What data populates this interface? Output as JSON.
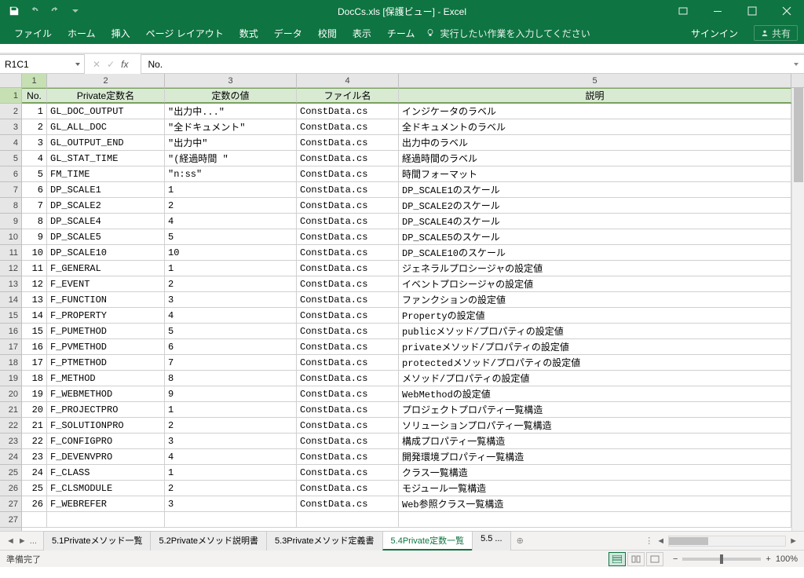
{
  "app": {
    "title": "DocCs.xls [保護ビュー] - Excel",
    "signin": "サインイン",
    "share": "共有",
    "tellme_placeholder": "実行したい作業を入力してください"
  },
  "ribbon": {
    "tabs": [
      "ファイル",
      "ホーム",
      "挿入",
      "ページ レイアウト",
      "数式",
      "データ",
      "校閲",
      "表示",
      "チーム"
    ]
  },
  "namebox": "R1C1",
  "formula": "No.",
  "col_numbers": [
    "1",
    "2",
    "3",
    "4",
    "5"
  ],
  "headers": {
    "no": "No.",
    "name": "Private定数名",
    "val": "定数の値",
    "file": "ファイル名",
    "desc": "説明"
  },
  "rows": [
    {
      "n": "1",
      "name": "GL_DOC_OUTPUT",
      "val": "\"出力中...\"",
      "file": "ConstData.cs",
      "desc": "インジケータのラベル"
    },
    {
      "n": "2",
      "name": "GL_ALL_DOC",
      "val": "\"全ドキュメント\"",
      "file": "ConstData.cs",
      "desc": "全ドキュメントのラベル"
    },
    {
      "n": "3",
      "name": "GL_OUTPUT_END",
      "val": "\"出力中\"",
      "file": "ConstData.cs",
      "desc": "出力中のラベル"
    },
    {
      "n": "4",
      "name": "GL_STAT_TIME",
      "val": "\"(経過時間 \"",
      "file": "ConstData.cs",
      "desc": "経過時間のラベル"
    },
    {
      "n": "5",
      "name": "FM_TIME",
      "val": "\"n:ss\"",
      "file": "ConstData.cs",
      "desc": "時間フォーマット"
    },
    {
      "n": "6",
      "name": "DP_SCALE1",
      "val": "1",
      "file": "ConstData.cs",
      "desc": "DP_SCALE1のスケール"
    },
    {
      "n": "7",
      "name": "DP_SCALE2",
      "val": "2",
      "file": "ConstData.cs",
      "desc": "DP_SCALE2のスケール"
    },
    {
      "n": "8",
      "name": "DP_SCALE4",
      "val": "4",
      "file": "ConstData.cs",
      "desc": "DP_SCALE4のスケール"
    },
    {
      "n": "9",
      "name": "DP_SCALE5",
      "val": "5",
      "file": "ConstData.cs",
      "desc": "DP_SCALE5のスケール"
    },
    {
      "n": "10",
      "name": "DP_SCALE10",
      "val": "10",
      "file": "ConstData.cs",
      "desc": "DP_SCALE10のスケール"
    },
    {
      "n": "11",
      "name": "F_GENERAL",
      "val": "1",
      "file": "ConstData.cs",
      "desc": "ジェネラルプロシージャの設定値"
    },
    {
      "n": "12",
      "name": "F_EVENT",
      "val": "2",
      "file": "ConstData.cs",
      "desc": "イベントプロシージャの設定値"
    },
    {
      "n": "13",
      "name": "F_FUNCTION",
      "val": "3",
      "file": "ConstData.cs",
      "desc": "ファンクションの設定値"
    },
    {
      "n": "14",
      "name": "F_PROPERTY",
      "val": "4",
      "file": "ConstData.cs",
      "desc": "Propertyの設定値"
    },
    {
      "n": "15",
      "name": "F_PUMETHOD",
      "val": "5",
      "file": "ConstData.cs",
      "desc": "publicメソッド/プロパティの設定値"
    },
    {
      "n": "16",
      "name": "F_PVMETHOD",
      "val": "6",
      "file": "ConstData.cs",
      "desc": "privateメソッド/プロパティの設定値"
    },
    {
      "n": "17",
      "name": "F_PTMETHOD",
      "val": "7",
      "file": "ConstData.cs",
      "desc": "protectedメソッド/プロパティの設定値"
    },
    {
      "n": "18",
      "name": "F_METHOD",
      "val": "8",
      "file": "ConstData.cs",
      "desc": "メソッド/プロパティの設定値"
    },
    {
      "n": "19",
      "name": "F_WEBMETHOD",
      "val": "9",
      "file": "ConstData.cs",
      "desc": "WebMethodの設定値"
    },
    {
      "n": "20",
      "name": "F_PROJECTPRO",
      "val": "1",
      "file": "ConstData.cs",
      "desc": "プロジェクトプロパティ一覧構造"
    },
    {
      "n": "21",
      "name": "F_SOLUTIONPRO",
      "val": "2",
      "file": "ConstData.cs",
      "desc": "ソリューションプロパティ一覧構造"
    },
    {
      "n": "22",
      "name": "F_CONFIGPRO",
      "val": "3",
      "file": "ConstData.cs",
      "desc": "構成プロパティ一覧構造"
    },
    {
      "n": "23",
      "name": "F_DEVENVPRO",
      "val": "4",
      "file": "ConstData.cs",
      "desc": "開発環境プロパティ一覧構造"
    },
    {
      "n": "24",
      "name": "F_CLASS",
      "val": "1",
      "file": "ConstData.cs",
      "desc": "クラス一覧構造"
    },
    {
      "n": "25",
      "name": "F_CLSMODULE",
      "val": "2",
      "file": "ConstData.cs",
      "desc": "モジュール一覧構造"
    },
    {
      "n": "26",
      "name": "F_WEBREFER",
      "val": "3",
      "file": "ConstData.cs",
      "desc": "Web参照クラス一覧構造"
    }
  ],
  "row_numbers_extra": [
    "27"
  ],
  "sheets": {
    "prev_ellipsis": "...",
    "tabs": [
      "5.1Privateメソッド一覧",
      "5.2Privateメソッド説明書",
      "5.3Privateメソッド定義書",
      "5.4Private定数一覧",
      "5.5 ..."
    ],
    "active_index": 3
  },
  "status": {
    "ready": "準備完了",
    "zoom": "100%"
  }
}
